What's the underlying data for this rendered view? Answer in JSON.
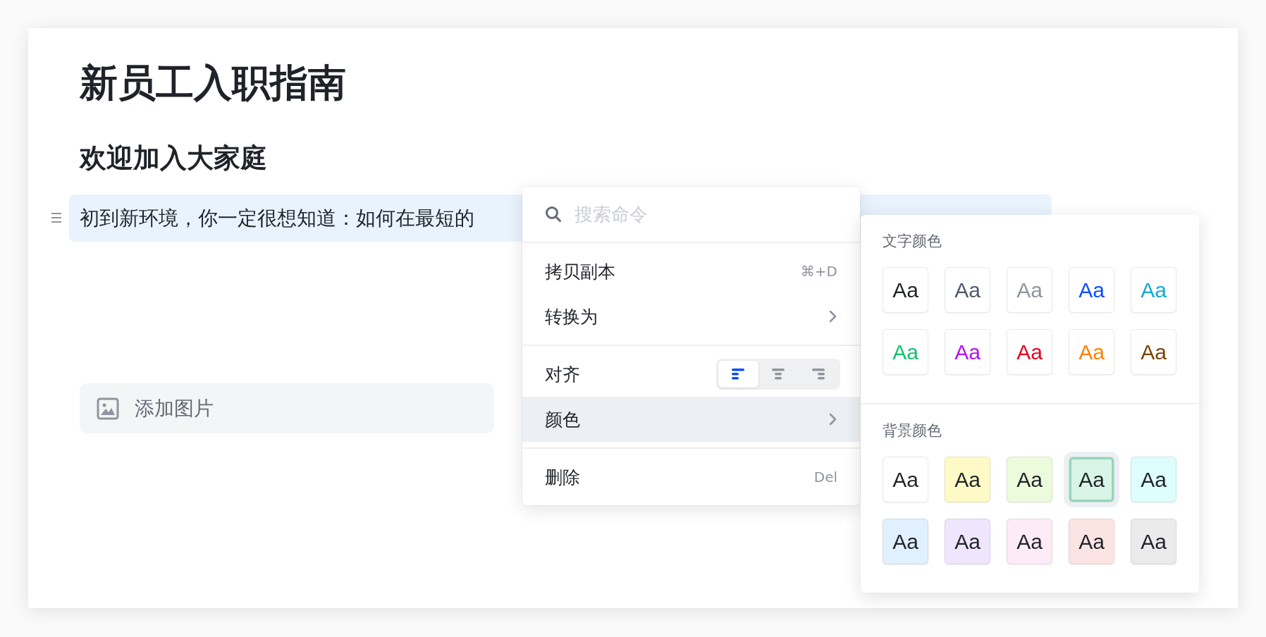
{
  "document": {
    "title": "新员工入职指南",
    "heading": "欢迎加入大家庭",
    "paragraph": {
      "text": "初到新环境，你一定很想知道：如何在最短的",
      "selected": true
    },
    "image_placeholder": {
      "label": "添加图片"
    }
  },
  "command_menu": {
    "search": {
      "placeholder": "搜索命令"
    },
    "sections": [
      [
        {
          "kind": "action",
          "label": "拷贝副本",
          "shortcut": "⌘+D",
          "highlighted": false
        },
        {
          "kind": "submenu",
          "label": "转换为",
          "highlighted": false
        }
      ],
      [
        {
          "kind": "align",
          "label": "对齐",
          "highlighted": false,
          "options": [
            {
              "kind": "left",
              "selected": true
            },
            {
              "kind": "center",
              "selected": false
            },
            {
              "kind": "right",
              "selected": false
            }
          ]
        },
        {
          "kind": "submenu",
          "label": "颜色",
          "highlighted": true
        }
      ],
      [
        {
          "kind": "action",
          "label": "删除",
          "shortcut": "Del",
          "highlighted": false
        }
      ]
    ]
  },
  "color_panel": {
    "groups": [
      {
        "kind": "text",
        "title": "文字颜色",
        "swatches": [
          {
            "label": "Aa",
            "color": "#1f2329",
            "selected": false
          },
          {
            "label": "Aa",
            "color": "#4e5969",
            "selected": false
          },
          {
            "label": "Aa",
            "color": "#8f959e",
            "selected": false
          },
          {
            "label": "Aa",
            "color": "#0a4cff",
            "selected": false
          },
          {
            "label": "Aa",
            "color": "#14a9d5",
            "selected": false
          },
          {
            "label": "Aa",
            "color": "#14c06b",
            "selected": false
          },
          {
            "label": "Aa",
            "color": "#b212f0",
            "selected": false
          },
          {
            "label": "Aa",
            "color": "#e6001f",
            "selected": false
          },
          {
            "label": "Aa",
            "color": "#ff8000",
            "selected": false
          },
          {
            "label": "Aa",
            "color": "#7a4300",
            "selected": false
          }
        ]
      },
      {
        "kind": "background",
        "title": "背景颜色",
        "swatches": [
          {
            "label": "Aa",
            "color": "#ffffff",
            "selected": false
          },
          {
            "label": "Aa",
            "color": "#fefac6",
            "selected": false
          },
          {
            "label": "Aa",
            "color": "#ecfbdc",
            "selected": false
          },
          {
            "label": "Aa",
            "color": "#d9f5e8",
            "selected": true
          },
          {
            "label": "Aa",
            "color": "#defdfd",
            "selected": false
          },
          {
            "label": "Aa",
            "color": "#e0f0fe",
            "selected": false
          },
          {
            "label": "Aa",
            "color": "#efe5fc",
            "selected": false
          },
          {
            "label": "Aa",
            "color": "#fdebf7",
            "selected": false
          },
          {
            "label": "Aa",
            "color": "#fde4e4",
            "selected": false
          },
          {
            "label": "Aa",
            "color": "#ebebeb",
            "selected": false
          }
        ]
      }
    ]
  }
}
